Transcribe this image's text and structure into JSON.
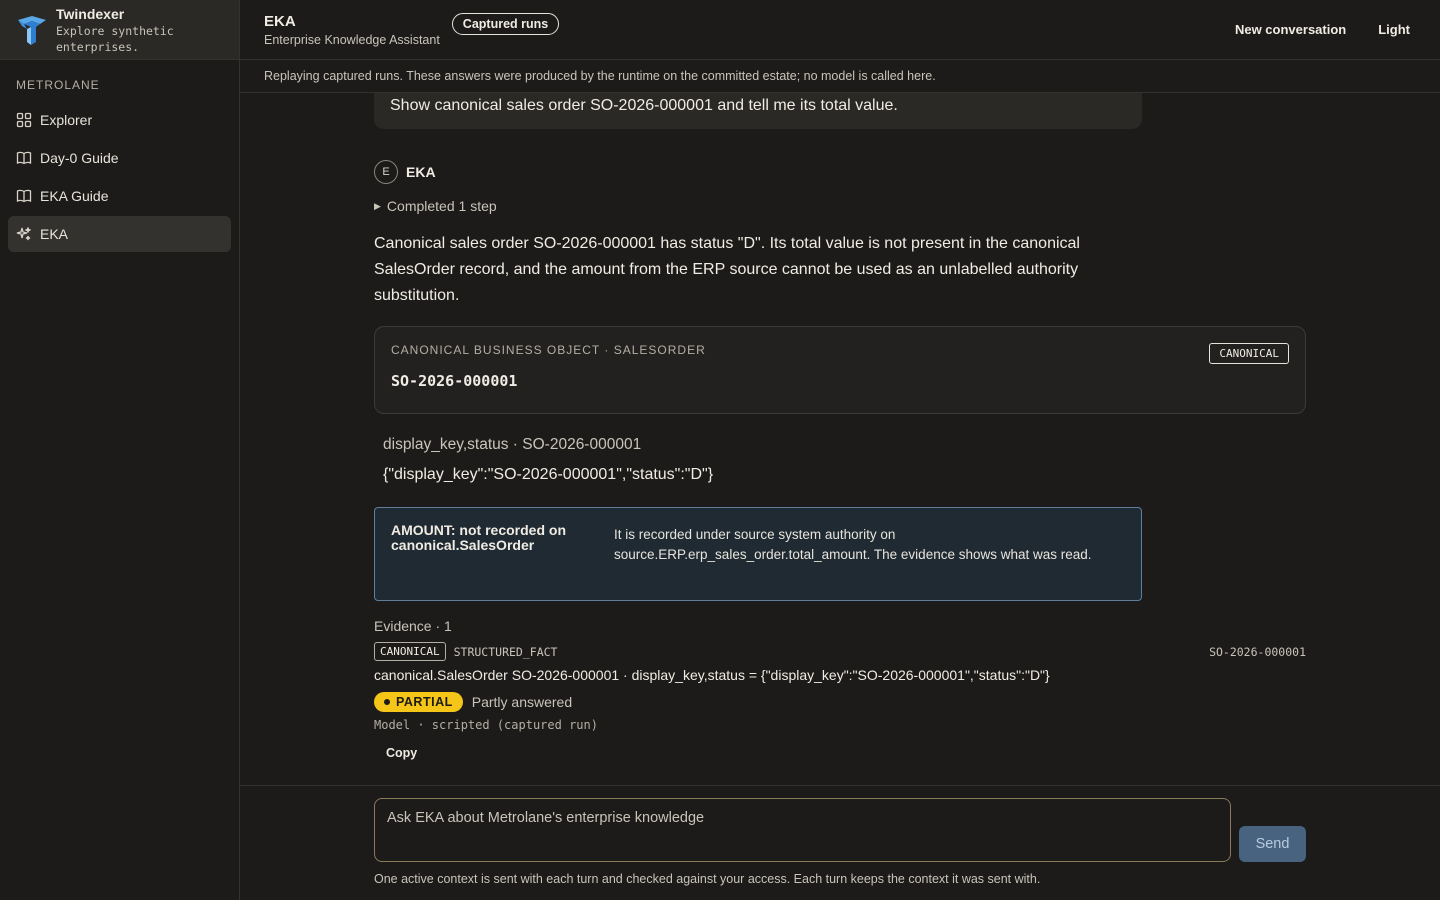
{
  "sidebar": {
    "brand_name": "Twindexer",
    "brand_tagline": "Explore synthetic enterprises.",
    "section_label": "METROLANE",
    "items": [
      {
        "label": "Explorer",
        "icon": "grid-icon"
      },
      {
        "label": "Day-0 Guide",
        "icon": "book-icon"
      },
      {
        "label": "EKA Guide",
        "icon": "book-icon"
      },
      {
        "label": "EKA",
        "icon": "sparkle-icon",
        "active": true
      }
    ]
  },
  "header": {
    "title": "EKA",
    "subtitle": "Enterprise Knowledge Assistant",
    "pill": "Captured runs",
    "new_conversation": "New conversation",
    "theme_toggle": "Light"
  },
  "banner": "Replaying captured runs. These answers were produced by the runtime on the committed estate; no model is called here.",
  "conversation": {
    "user_message": "Show canonical sales order SO-2026-000001 and tell me its total value.",
    "assistant_avatar": "E",
    "assistant_name": "EKA",
    "steps": "Completed 1 step",
    "answer": "Canonical sales order SO-2026-000001 has status \"D\". Its total value is not present in the canonical SalesOrder record, and the amount from the ERP source cannot be used as an unlabelled authority substitution.",
    "object_card": {
      "kicker": "CANONICAL BUSINESS OBJECT · SALESORDER",
      "key": "SO-2026-000001",
      "tag": "CANONICAL"
    },
    "field_label": "display_key,status · SO-2026-000001",
    "field_value": "{\"display_key\":\"SO-2026-000001\",\"status\":\"D\"}",
    "notice": {
      "title": "AMOUNT: not recorded on canonical.SalesOrder",
      "body": "It is recorded under source system authority on source.ERP.erp_sales_order.total_amount. The evidence shows what was read."
    },
    "evidence": {
      "label": "Evidence · 1",
      "tag": "CANONICAL",
      "kind": "STRUCTURED_FACT",
      "key": "SO-2026-000001",
      "text": "canonical.SalesOrder SO-2026-000001 · display_key,status = {\"display_key\":\"SO-2026-000001\",\"status\":\"D\"}"
    },
    "status_badge": "PARTIAL",
    "status_text": "Partly answered",
    "model_line": "Model · scripted (captured run)",
    "copy_label": "Copy"
  },
  "composer": {
    "placeholder": "Ask EKA about Metrolane's enterprise knowledge",
    "send_label": "Send",
    "note": "One active context is sent with each turn and checked against your access. Each turn keeps the context it was sent with."
  },
  "colors": {
    "background": "#1c1b19",
    "accent_partial": "#f5c518",
    "send_button": "#48637f",
    "notice_border": "#5f7e9c"
  }
}
